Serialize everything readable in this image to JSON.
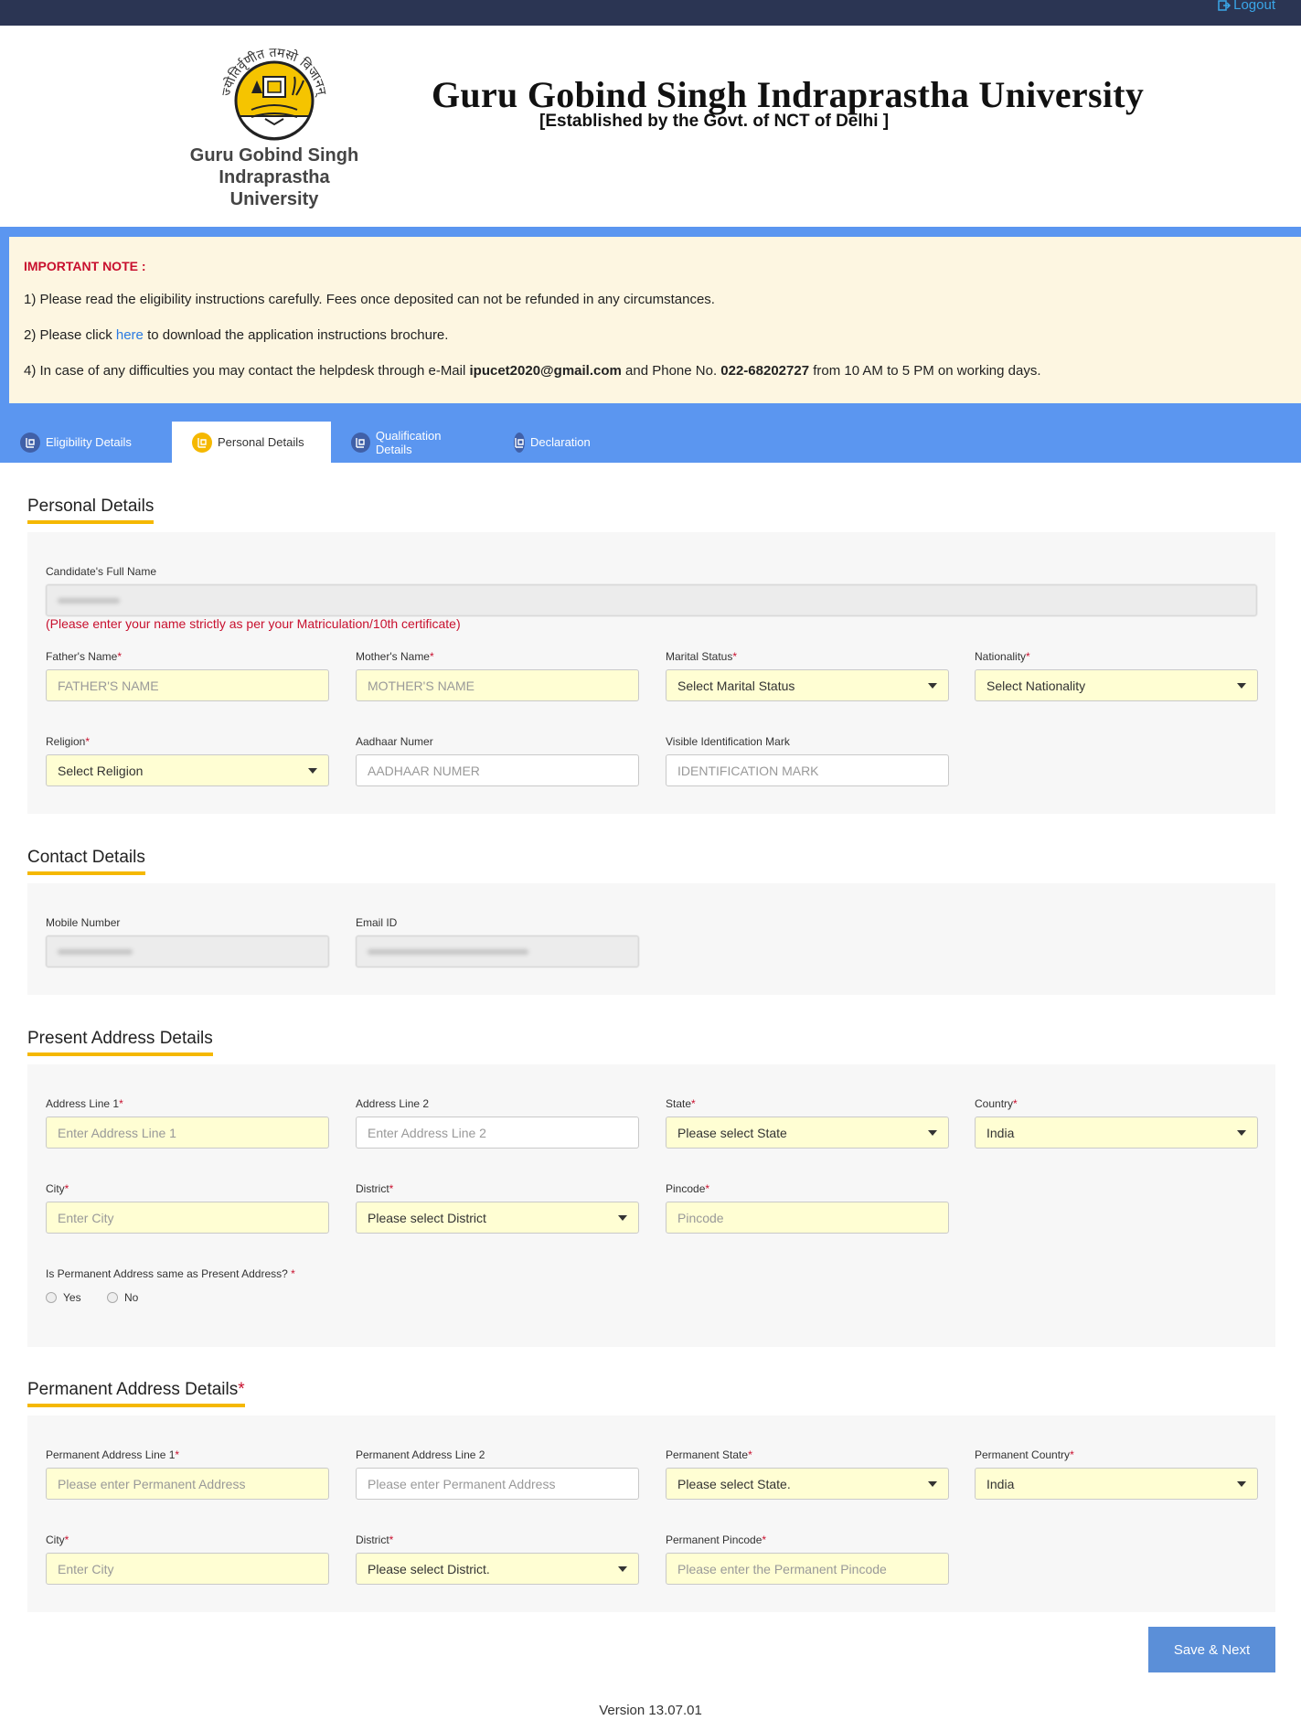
{
  "topbar": {
    "logout_label": "Logout"
  },
  "header": {
    "logo_devanagari": "ज्योतिर्वृणीत तमसो विजानन्",
    "logo_text_line1": "Guru Gobind Singh",
    "logo_text_line2": "Indraprastha",
    "logo_text_line3": "University",
    "title": "Guru Gobind Singh Indraprastha University",
    "subtitle": "[Established by the Govt. of NCT of Delhi ]"
  },
  "note": {
    "title": "IMPORTANT NOTE :",
    "line1": "1) Please read the eligibility instructions carefully. Fees once deposited can not be refunded in any circumstances.",
    "line2_pre": "2) Please click ",
    "line2_link": "here",
    "line2_post": " to download the application instructions brochure.",
    "line4_pre": "4) In case of any difficulties you may contact the helpdesk through e-Mail ",
    "line4_email": "ipucet2020@gmail.com",
    "line4_mid": " and Phone No. ",
    "line4_phone": "022-68202727",
    "line4_post": " from 10 AM to 5 PM on working days."
  },
  "tabs": [
    {
      "label": "Eligibility Details"
    },
    {
      "label": "Personal Details"
    },
    {
      "label": "Qualification Details"
    },
    {
      "label": "Declaration"
    }
  ],
  "personal": {
    "section_title": "Personal Details",
    "full_name_label": "Candidate's Full Name",
    "full_name_error": "(Please enter your name strictly as per your Matriculation/10th certificate)",
    "father_label": "Father's Name",
    "father_placeholder": "FATHER'S NAME",
    "mother_label": "Mother's Name",
    "mother_placeholder": "MOTHER'S NAME",
    "marital_label": "Marital Status",
    "marital_value": "Select Marital Status",
    "nationality_label": "Nationality",
    "nationality_value": "Select Nationality",
    "religion_label": "Religion",
    "religion_value": "Select Religion",
    "aadhaar_label": "Aadhaar Numer",
    "aadhaar_placeholder": "AADHAAR NUMER",
    "idmark_label": "Visible Identification Mark",
    "idmark_placeholder": "IDENTIFICATION MARK"
  },
  "contact": {
    "section_title": "Contact Details",
    "mobile_label": "Mobile Number",
    "email_label": "Email ID"
  },
  "present": {
    "section_title": "Present Address Details",
    "addr1_label": "Address Line 1",
    "addr1_placeholder": "Enter Address Line 1",
    "addr2_label": "Address Line 2",
    "addr2_placeholder": "Enter Address Line 2",
    "state_label": "State",
    "state_value": "Please select State",
    "country_label": "Country",
    "country_value": "India",
    "city_label": "City",
    "city_placeholder": "Enter City",
    "district_label": "District",
    "district_value": "Please select District",
    "pincode_label": "Pincode",
    "pincode_placeholder": "Pincode",
    "same_question": "Is Permanent Address same as Present Address?",
    "yes_label": "Yes",
    "no_label": "No"
  },
  "permanent": {
    "section_title": "Permanent Address Details",
    "addr1_label": "Permanent Address Line 1",
    "addr1_placeholder": "Please enter Permanent Address",
    "addr2_label": "Permanent Address Line 2",
    "addr2_placeholder": "Please enter Permanent Address",
    "state_label": "Permanent State",
    "state_value": "Please select State.",
    "country_label": "Permanent Country",
    "country_value": "India",
    "city_label": "City",
    "city_placeholder": "Enter City",
    "district_label": "District",
    "district_value": "Please select District.",
    "pincode_label": "Permanent Pincode",
    "pincode_placeholder": "Please enter the Permanent Pincode"
  },
  "actions": {
    "save_next_label": "Save & Next"
  },
  "footer": {
    "version": "Version 13.07.01"
  },
  "colors": {
    "accent_yellow": "#f5b800",
    "tab_bar_blue": "#5b96f0",
    "topbar": "#2b3553",
    "required_red": "#c8102e"
  }
}
